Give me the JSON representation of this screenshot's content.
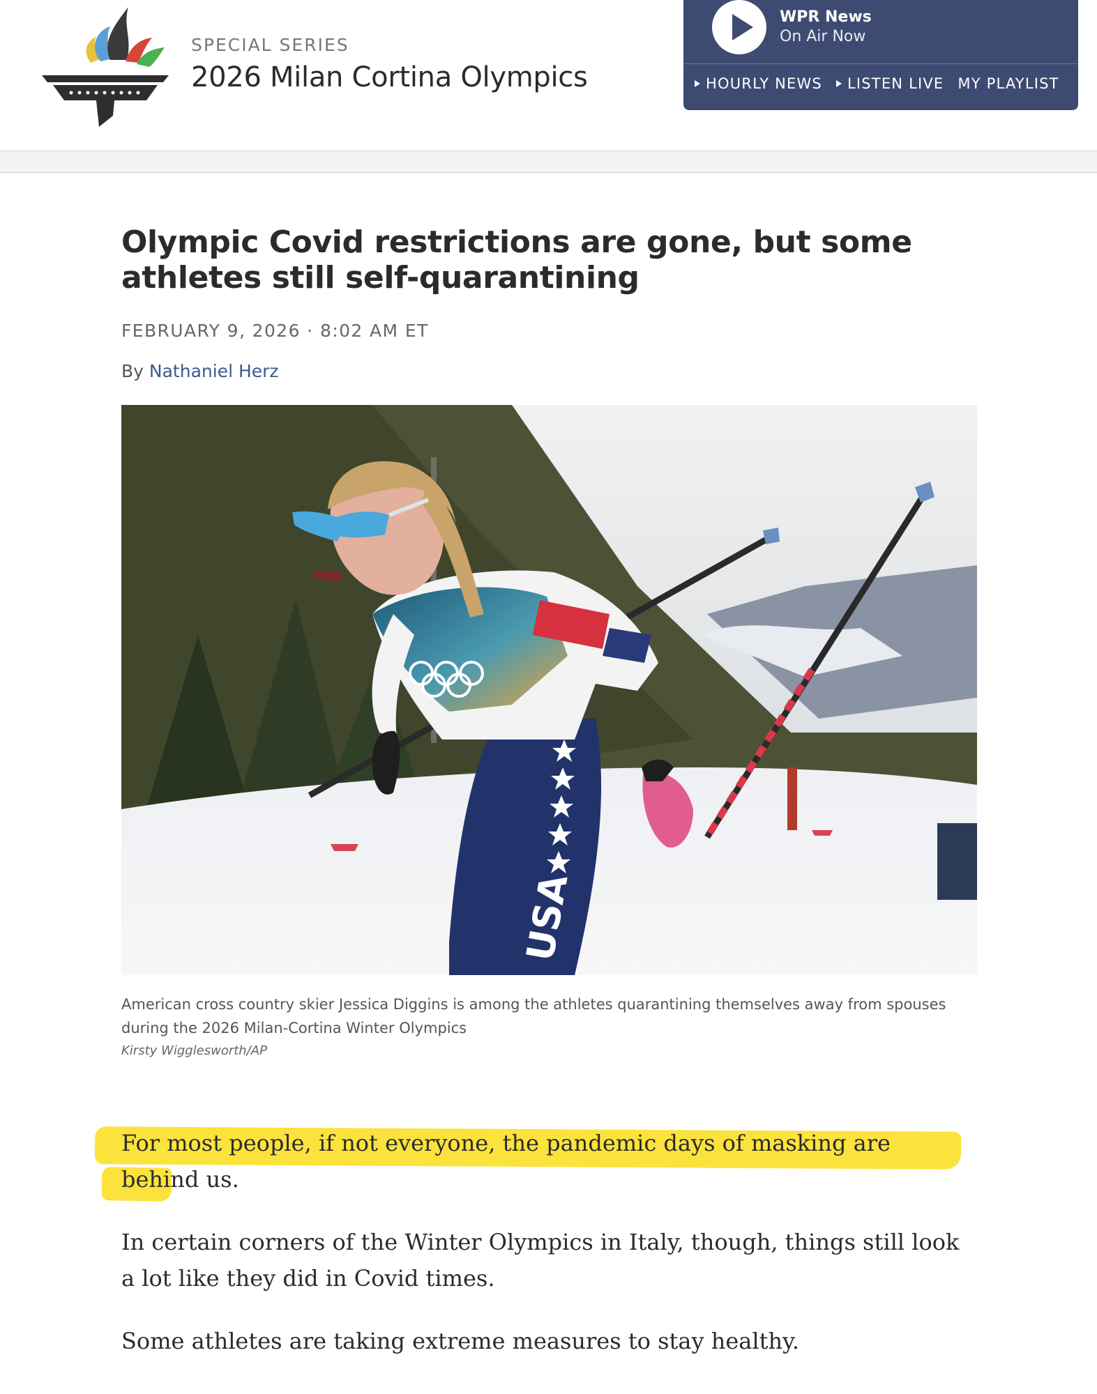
{
  "colors": {
    "player_bg": "#3d4b73",
    "author_link": "#3c5a8a",
    "highlight": "#fbe23d"
  },
  "logo": {
    "icon": "olympic-torch-logo"
  },
  "series": {
    "kicker": "SPECIAL SERIES",
    "title": "2026 Milan Cortina Olympics"
  },
  "player": {
    "play_icon": "play-icon",
    "station": "WPR News",
    "status": "On Air Now",
    "links": [
      {
        "label": "HOURLY NEWS",
        "icon": "triangle-right-icon"
      },
      {
        "label": "LISTEN LIVE",
        "icon": "triangle-right-icon"
      },
      {
        "label": "MY PLAYLIST"
      }
    ]
  },
  "article": {
    "headline": "Olympic Covid restrictions are gone, but some athletes still self-quarantining",
    "dateline": "FEBRUARY 9, 2026 · 8:02 AM ET",
    "byline_prefix": "By",
    "author": "Nathaniel Herz",
    "image_caption": "American cross country skier Jessica Diggins is among the athletes quarantining themselves away from spouses during the 2026 Milan-Cortina Winter Olympics",
    "image_credit": "Kirsty Wigglesworth/AP",
    "paragraphs": [
      "For most people, if not everyone, the pandemic days of masking are behind us.",
      "In certain corners of the Winter Olympics in Italy, though, things still look a lot like they did in Covid times.",
      "Some athletes are taking extreme measures to stay healthy."
    ]
  }
}
